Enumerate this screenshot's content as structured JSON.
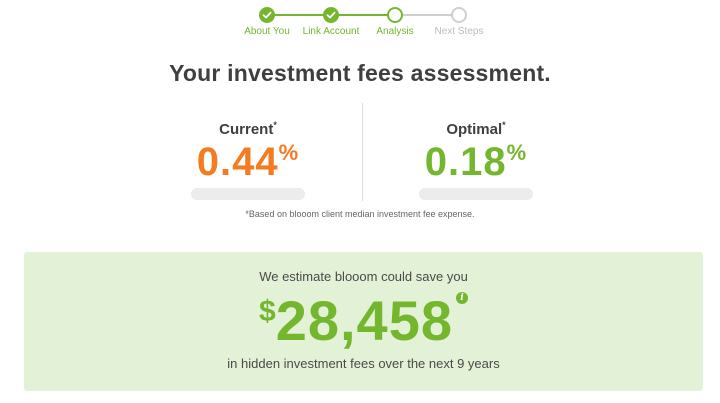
{
  "stepper": {
    "steps": [
      {
        "label": "About You",
        "state": "done"
      },
      {
        "label": "Link Account",
        "state": "done"
      },
      {
        "label": "Analysis",
        "state": "current"
      },
      {
        "label": "Next Steps",
        "state": "todo"
      }
    ]
  },
  "heading": "Your investment fees assessment.",
  "current": {
    "title": "Current",
    "asterisk": "*",
    "value": "0.44",
    "unit": "%"
  },
  "optimal": {
    "title": "Optimal",
    "asterisk": "*",
    "value": "0.18",
    "unit": "%"
  },
  "footnote": "*Based on blooom client median investment fee expense.",
  "savings": {
    "intro": "We estimate blooom could save you",
    "currency": "$",
    "amount": "28,458",
    "info_icon": "info-icon",
    "outro": "in hidden investment fees over the next 9 years"
  },
  "colors": {
    "green": "#74b72e",
    "orange": "#f47b20",
    "panel": "#e3f1d6"
  }
}
